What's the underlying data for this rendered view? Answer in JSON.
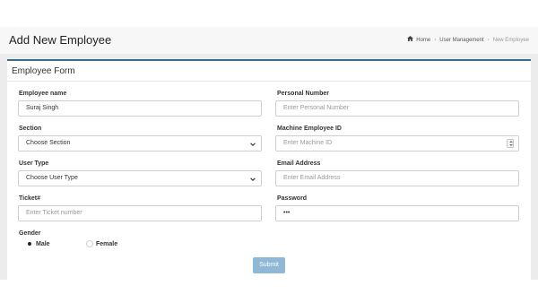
{
  "page": {
    "title": "Add New Employee",
    "breadcrumb": [
      "Home",
      "User Management",
      "New Employee"
    ]
  },
  "form": {
    "title": "Employee Form",
    "employee_name": {
      "label": "Employee name",
      "value": "Suraj Singh"
    },
    "personal_number": {
      "label": "Personal Number",
      "placeholder": "Enter Personal Number"
    },
    "section": {
      "label": "Section",
      "selected": "Choose Section"
    },
    "machine_employee_id": {
      "label": "Machine Employee ID",
      "placeholder": "Enter Machine ID"
    },
    "user_type": {
      "label": "User Type",
      "selected": "Choose User Type"
    },
    "email": {
      "label": "Email Address",
      "placeholder": "Enter Email Address"
    },
    "ticket": {
      "label": "Ticket#",
      "placeholder": "Enter Ticket number"
    },
    "password": {
      "label": "Password",
      "value": "•••"
    },
    "gender": {
      "label": "Gender",
      "options": [
        "Male",
        "Female"
      ],
      "selected": "Male"
    },
    "submit_label": "Submit"
  },
  "colors": {
    "accent": "#3a6e8c",
    "submit": "#8fb8d6"
  },
  "icons": {
    "home": "home-icon",
    "select_arrow": "chevron-down-icon",
    "number_spinner": "spinner-icon"
  }
}
